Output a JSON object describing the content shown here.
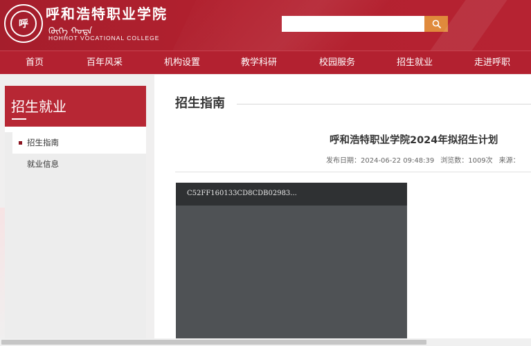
{
  "header": {
    "logo_cn": "呼和浩特职业学院",
    "logo_mongol": "ᠬᠥᠬᠡ ᠬᠣᠲᠠ",
    "logo_en": "HOHHOT VOCATIONAL COLLEGE",
    "logo_seal_text": "呼",
    "search_placeholder": "",
    "search_value": ""
  },
  "nav": {
    "items": [
      {
        "label": "首页"
      },
      {
        "label": "百年风采"
      },
      {
        "label": "机构设置"
      },
      {
        "label": "教学科研"
      },
      {
        "label": "校园服务"
      },
      {
        "label": "招生就业"
      },
      {
        "label": "走进呼职"
      }
    ]
  },
  "sidebar": {
    "title": "招生就业",
    "items": [
      {
        "label": "招生指南",
        "active": true
      },
      {
        "label": "就业信息",
        "active": false
      }
    ]
  },
  "content": {
    "section_title": "招生指南",
    "article_title": "呼和浩特职业学院2024年拟招生计划",
    "meta": {
      "publish_date": "发布日期：2024-06-22 09:48:39",
      "views": "浏览数：1009次",
      "source": "来源："
    },
    "video": {
      "filename": "C52FF160133CD8CDB02983..."
    }
  },
  "colors": {
    "brand_red": "#b32130",
    "search_button": "#e08a3c",
    "sidebar_head": "#b72734"
  }
}
